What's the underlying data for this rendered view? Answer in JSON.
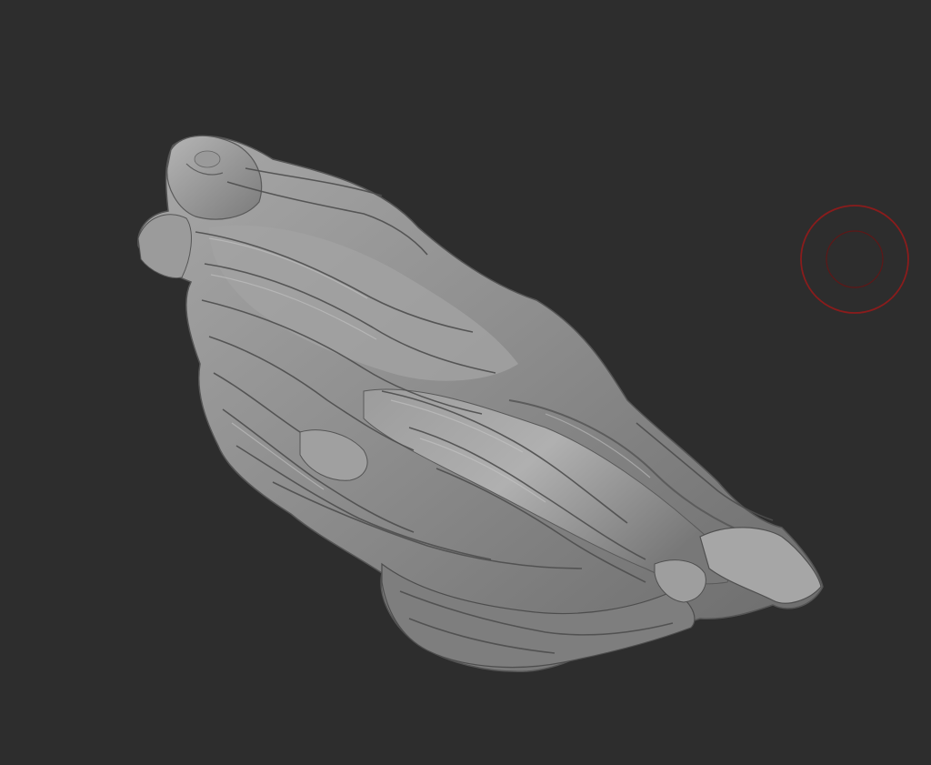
{
  "viewport": {
    "background_color": "#2d2d2d",
    "mesh_color": "#8c8c8c",
    "mesh_highlight_color": "#c4c4c4",
    "mesh_shadow_color": "#3a3a3a",
    "brush_cursor_color": "#8a1c1c"
  },
  "model": {
    "icon": "veiled-reclining-figure-sculpt"
  },
  "brush_cursor": {
    "icon": "brush-radius-ring-icon"
  }
}
